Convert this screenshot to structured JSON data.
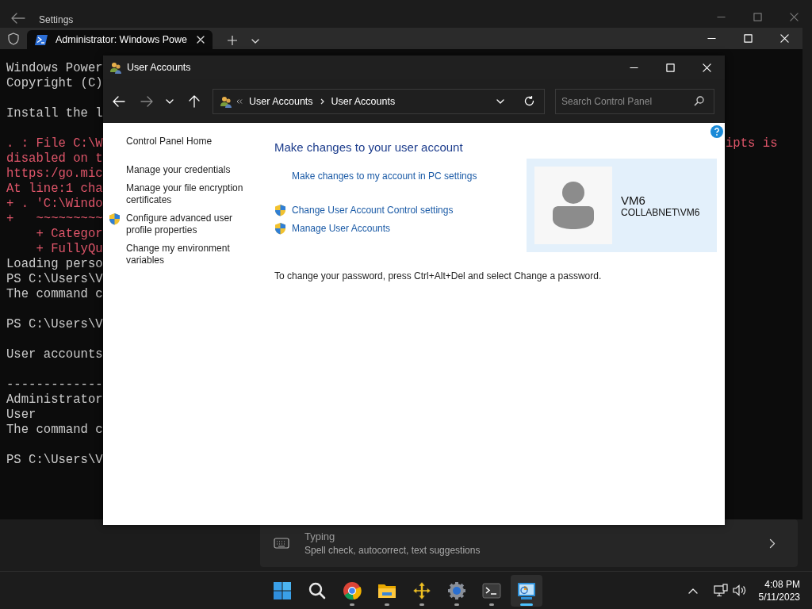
{
  "settings_window": {
    "title": "Settings",
    "typing_card": {
      "title": "Typing",
      "subtitle": "Spell check, autocorrect, text suggestions"
    }
  },
  "terminal": {
    "tab": {
      "title": "Administrator: Windows Powe",
      "selected": true
    },
    "lines": [
      {
        "kind": "output",
        "text": "Windows Power"
      },
      {
        "kind": "output",
        "text": "Copyright (C)"
      },
      {
        "kind": "blank"
      },
      {
        "kind": "output",
        "text": "Install the l"
      },
      {
        "kind": "blank"
      },
      {
        "kind": "error",
        "text": ". : File C:\\W",
        "right": "ipts is"
      },
      {
        "kind": "error",
        "text": "disabled on t"
      },
      {
        "kind": "error",
        "text": "https:/go.mic"
      },
      {
        "kind": "error",
        "text": "At line:1 cha"
      },
      {
        "kind": "error",
        "text": "+ . 'C:\\Windo"
      },
      {
        "kind": "error",
        "text": "+   ~~~~~~~~~"
      },
      {
        "kind": "error",
        "text": "    + Categor"
      },
      {
        "kind": "error",
        "text": "    + FullyQu"
      },
      {
        "kind": "output",
        "text": "Loading perso"
      },
      {
        "kind": "output",
        "text": "PS C:\\Users\\V"
      },
      {
        "kind": "output",
        "text": "The command c"
      },
      {
        "kind": "blank"
      },
      {
        "kind": "output",
        "text": "PS C:\\Users\\V"
      },
      {
        "kind": "blank"
      },
      {
        "kind": "output",
        "text": "User accounts"
      },
      {
        "kind": "blank"
      },
      {
        "kind": "output",
        "text": "-------------"
      },
      {
        "kind": "output",
        "text": "Administrator"
      },
      {
        "kind": "output",
        "text": "User"
      },
      {
        "kind": "output",
        "text": "The command c"
      },
      {
        "kind": "blank"
      },
      {
        "kind": "output",
        "text": "PS C:\\Users\\V"
      }
    ]
  },
  "user_accounts": {
    "title": "User Accounts",
    "breadcrumb": [
      "User Accounts",
      "User Accounts"
    ],
    "search": {
      "placeholder": "Search Control Panel"
    },
    "sidebar": {
      "items": [
        {
          "kind": "home",
          "label": "Control Panel Home"
        },
        {
          "kind": "link",
          "label": "Manage your credentials"
        },
        {
          "kind": "link",
          "label": "Manage your file encryption certificates"
        },
        {
          "kind": "shield",
          "label": "Configure advanced user profile properties"
        },
        {
          "kind": "link",
          "label": "Change my environment variables"
        }
      ]
    },
    "heading": "Make changes to your user account",
    "tasks": [
      {
        "kind": "link",
        "label": "Make changes to my account in PC settings"
      },
      {
        "kind": "shield",
        "label": "Change User Account Control settings"
      },
      {
        "kind": "shield",
        "label": "Manage User Accounts"
      }
    ],
    "account": {
      "name": "VM6",
      "domain": "COLLABNET\\VM6"
    },
    "note": "To change your password, press Ctrl+Alt+Del and select Change a password."
  },
  "taskbar": {
    "apps": [
      {
        "kind": "start",
        "running": false,
        "active": false
      },
      {
        "kind": "search",
        "running": false,
        "active": false
      },
      {
        "kind": "chrome",
        "running": true,
        "active": false
      },
      {
        "kind": "folder",
        "running": true,
        "active": false
      },
      {
        "kind": "vm",
        "running": true,
        "active": false
      },
      {
        "kind": "settings",
        "running": true,
        "active": false
      },
      {
        "kind": "terminal",
        "running": true,
        "active": false
      },
      {
        "kind": "control-panel",
        "running": true,
        "active": true
      }
    ],
    "clock": {
      "time": "4:08 PM",
      "date": "5/11/2023"
    }
  }
}
